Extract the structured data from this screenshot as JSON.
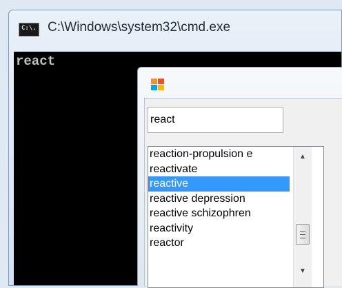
{
  "cmd": {
    "title": "C:\\Windows\\system32\\cmd.exe",
    "icon_text": "C:\\.",
    "console_text": "react"
  },
  "dialog": {
    "search": {
      "value": "react"
    },
    "list": {
      "items": [
        "reaction-propulsion e",
        "reactivate",
        "reactive",
        "reactive depression",
        "reactive schizophren",
        "reactivity",
        "reactor"
      ],
      "selected_index": 2
    },
    "scrollbar": {
      "up": "▲",
      "down": "▼"
    }
  },
  "colors": {
    "selection": "#3399ff",
    "console_bg": "#000000",
    "console_fg": "#c0c0c0"
  }
}
